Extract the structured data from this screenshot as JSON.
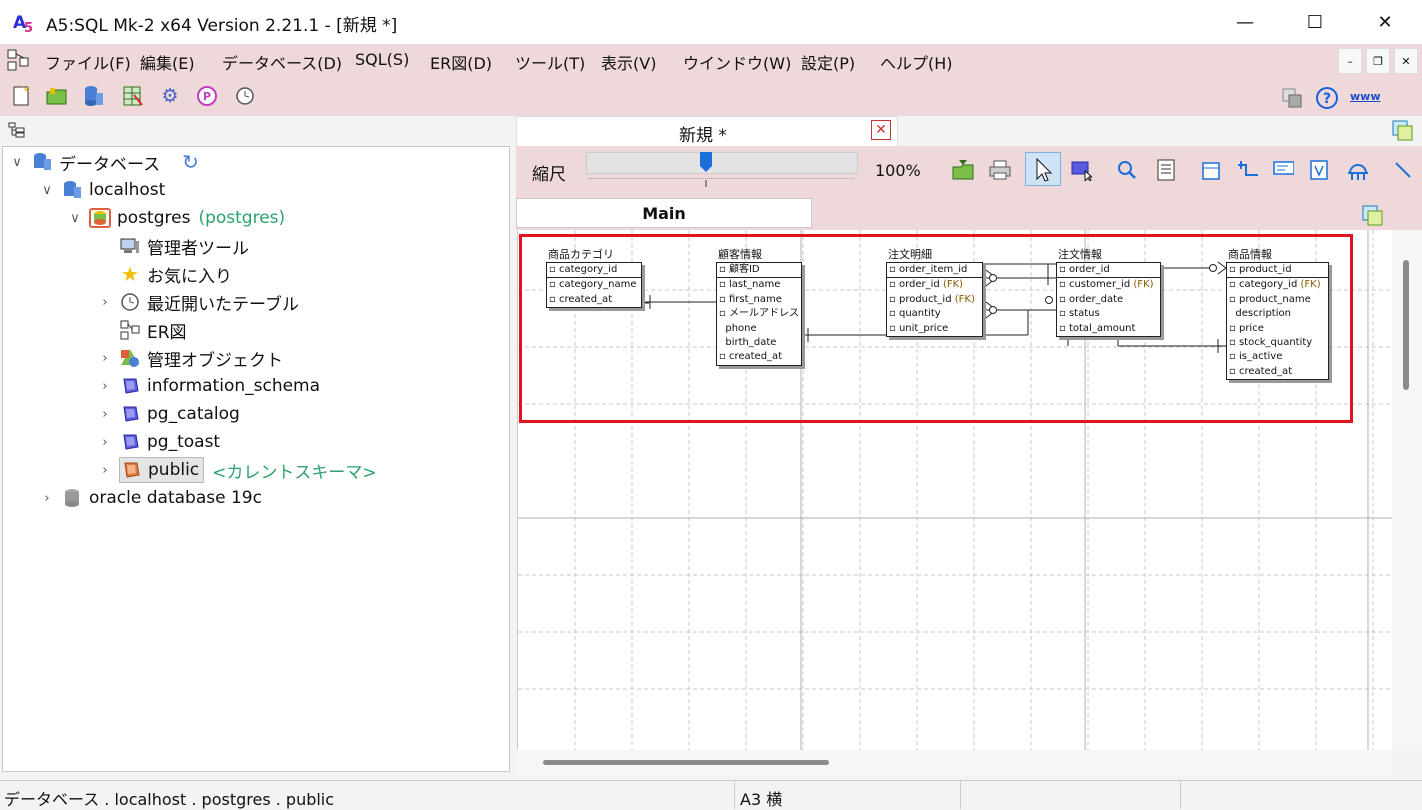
{
  "window": {
    "title": "A5:SQL Mk-2 x64 Version 2.21.1 - [新規 *]",
    "controls": [
      "—",
      "☐",
      "✕"
    ]
  },
  "menu": [
    "ファイル(F)",
    "編集(E)",
    "データベース(D)",
    "SQL(S)",
    "ER図(D)",
    "ツール(T)",
    "表示(V)",
    "ウインドウ(W)",
    "設定(P)",
    "ヘルプ(H)"
  ],
  "mdi_controls": [
    "–",
    "❐",
    "✕"
  ],
  "toolbar_icons": [
    "new-file-icon",
    "open-folder-icon",
    "database-icon",
    "table-edit-icon",
    "gear-icon",
    "plugin-icon",
    "history-icon"
  ],
  "toolbar_right": {
    "www": "www",
    "help": "?"
  },
  "tree": {
    "root": "データベース",
    "localhost": "localhost",
    "postgres": "postgres",
    "postgres_sub": "(postgres)",
    "items": [
      "管理者ツール",
      "お気に入り",
      "最近開いたテーブル",
      "ER図",
      "管理オブジェクト",
      "information_schema",
      "pg_catalog",
      "pg_toast"
    ],
    "public": "public",
    "public_note": "<カレントスキーマ>",
    "oracle": "oracle database 19c"
  },
  "erd": {
    "tab_title": "新規 *",
    "zoom_label": "縮尺",
    "zoom_value": "100%",
    "zoom_percent": 100,
    "main_tab": "Main",
    "entities": [
      {
        "title": "商品カテゴリ",
        "pk": [
          "category_id"
        ],
        "attrs": [
          "category_name",
          "created_at"
        ]
      },
      {
        "title": "顧客情報",
        "pk": [
          "顧客ID"
        ],
        "attrs": [
          "last_name",
          "first_name",
          "メールアドレス",
          "phone",
          "birth_date",
          "created_at"
        ]
      },
      {
        "title": "注文明細",
        "pk": [
          "order_item_id"
        ],
        "attrs": [
          "order_id",
          "product_id",
          "quantity",
          "unit_price"
        ],
        "fk": [
          0,
          1
        ]
      },
      {
        "title": "注文情報",
        "pk": [
          "order_id"
        ],
        "attrs": [
          "customer_id",
          "order_date",
          "status",
          "total_amount"
        ],
        "fk": [
          0
        ]
      },
      {
        "title": "商品情報",
        "pk": [
          "product_id"
        ],
        "attrs": [
          "category_id",
          "product_name",
          "description",
          "price",
          "stock_quantity",
          "is_active",
          "created_at"
        ],
        "fk": [
          0
        ]
      }
    ],
    "fk_label": "(FK)"
  },
  "status": {
    "path": "データベース . localhost . postgres . public",
    "paper": "A3 横"
  }
}
